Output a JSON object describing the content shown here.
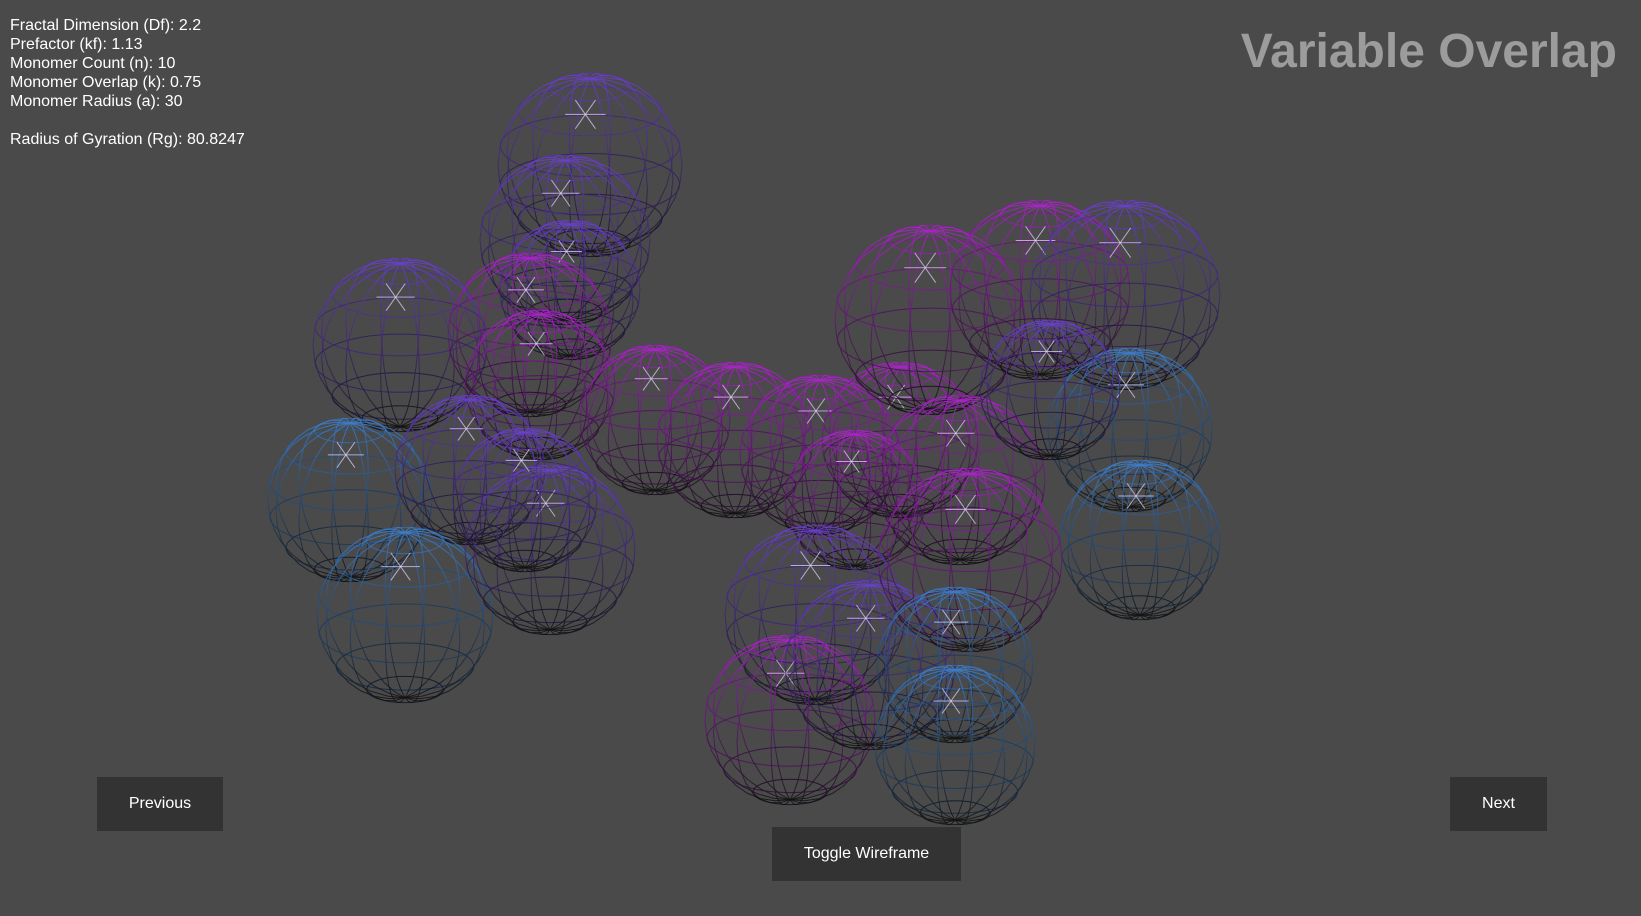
{
  "title": "Variable Overlap",
  "info": {
    "fractal_dimension": "Fractal Dimension (Df): 2.2",
    "prefactor": "Prefactor (kf): 1.13",
    "monomer_count": "Monomer Count (n): 10",
    "monomer_overlap": "Monomer Overlap (k): 0.75",
    "monomer_radius": "Monomer Radius (a): 30",
    "radius_of_gyration": "Radius of Gyration (Rg): 80.8247"
  },
  "buttons": {
    "previous": "Previous",
    "next": "Next",
    "toggle_wireframe": "Toggle Wireframe"
  },
  "colors": {
    "background": "#4a4a4a",
    "button_bg": "#333333",
    "title": "#9c9c9c",
    "blue": "#3a7fd0",
    "purple": "#6a3fd0",
    "magenta": "#b020d0"
  },
  "scene": {
    "render_mode": "wireframe",
    "spheres": [
      {
        "color": "purple"
      },
      {
        "color": "purple"
      },
      {
        "color": "purple"
      },
      {
        "color": "purple"
      },
      {
        "color": "magenta"
      },
      {
        "color": "magenta"
      },
      {
        "color": "blue"
      },
      {
        "color": "purple"
      },
      {
        "color": "blue"
      },
      {
        "color": "purple"
      },
      {
        "color": "purple"
      },
      {
        "color": "magenta"
      },
      {
        "color": "magenta"
      },
      {
        "color": "magenta"
      },
      {
        "color": "magenta"
      },
      {
        "color": "magenta"
      },
      {
        "color": "magenta"
      },
      {
        "color": "magenta"
      },
      {
        "color": "magenta"
      },
      {
        "color": "purple"
      },
      {
        "color": "blue"
      },
      {
        "color": "purple"
      },
      {
        "color": "blue"
      },
      {
        "color": "purple"
      },
      {
        "color": "magenta"
      },
      {
        "color": "purple"
      },
      {
        "color": "magenta"
      },
      {
        "color": "blue"
      },
      {
        "color": "blue"
      }
    ]
  }
}
